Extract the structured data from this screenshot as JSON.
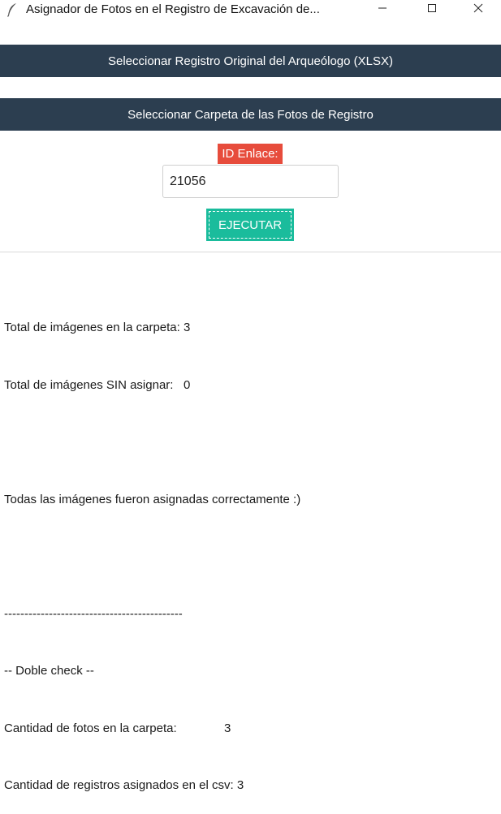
{
  "window": {
    "title": "Asignador de Fotos en el Registro de Excavación de...",
    "icon": "feather-icon",
    "controls": [
      "minimize-icon",
      "maximize-icon",
      "close-icon"
    ]
  },
  "buttons": {
    "select_xlsx": "Seleccionar Registro Original del Arqueólogo (XLSX)",
    "select_folder": "Seleccionar Carpeta de las Fotos de Registro",
    "execute": "EJECUTAR"
  },
  "id_field": {
    "label": "ID Enlace:",
    "value": "21056"
  },
  "output_lines": [
    "Total de imágenes en la carpeta: 3",
    "Total de imágenes SIN asignar:   0",
    "",
    "Todas las imágenes fueron asignadas correctamente :)",
    "",
    "--------------------------------------------",
    "-- Doble check --",
    "Cantidad de fotos en la carpeta:              3",
    "Cantidad de registros asignados en el csv: 3"
  ],
  "colors": {
    "dark_button": "#2c3e50",
    "label_red": "#e74c3c",
    "execute_green": "#1abc9c"
  }
}
